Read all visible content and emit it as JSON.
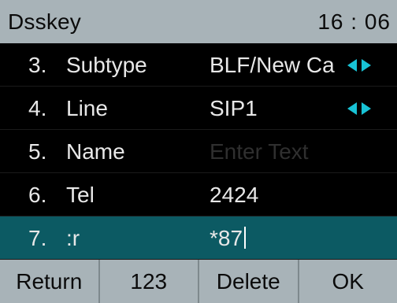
{
  "header": {
    "title": "Dsskey",
    "time": "16 : 06"
  },
  "rows": [
    {
      "num": "3.",
      "label": "Subtype",
      "value": "BLF/New Ca",
      "has_arrows": true
    },
    {
      "num": "4.",
      "label": "Line",
      "value": "SIP1",
      "has_arrows": true
    },
    {
      "num": "5.",
      "label": "Name",
      "placeholder": "Enter Text"
    },
    {
      "num": "6.",
      "label": "Tel",
      "value": "2424"
    },
    {
      "num": "7.",
      "label": ":r",
      "value": "*87",
      "selected": true
    }
  ],
  "softkeys": [
    "Return",
    "123",
    "Delete",
    "OK"
  ],
  "colors": {
    "bar_bg": "#a8b3b8",
    "selected_row": "#0c5a63",
    "arrow": "#18c3d6",
    "text": "#e8e8e8"
  },
  "icons": {
    "arrow_left": "left-triangle",
    "arrow_right": "right-triangle"
  }
}
